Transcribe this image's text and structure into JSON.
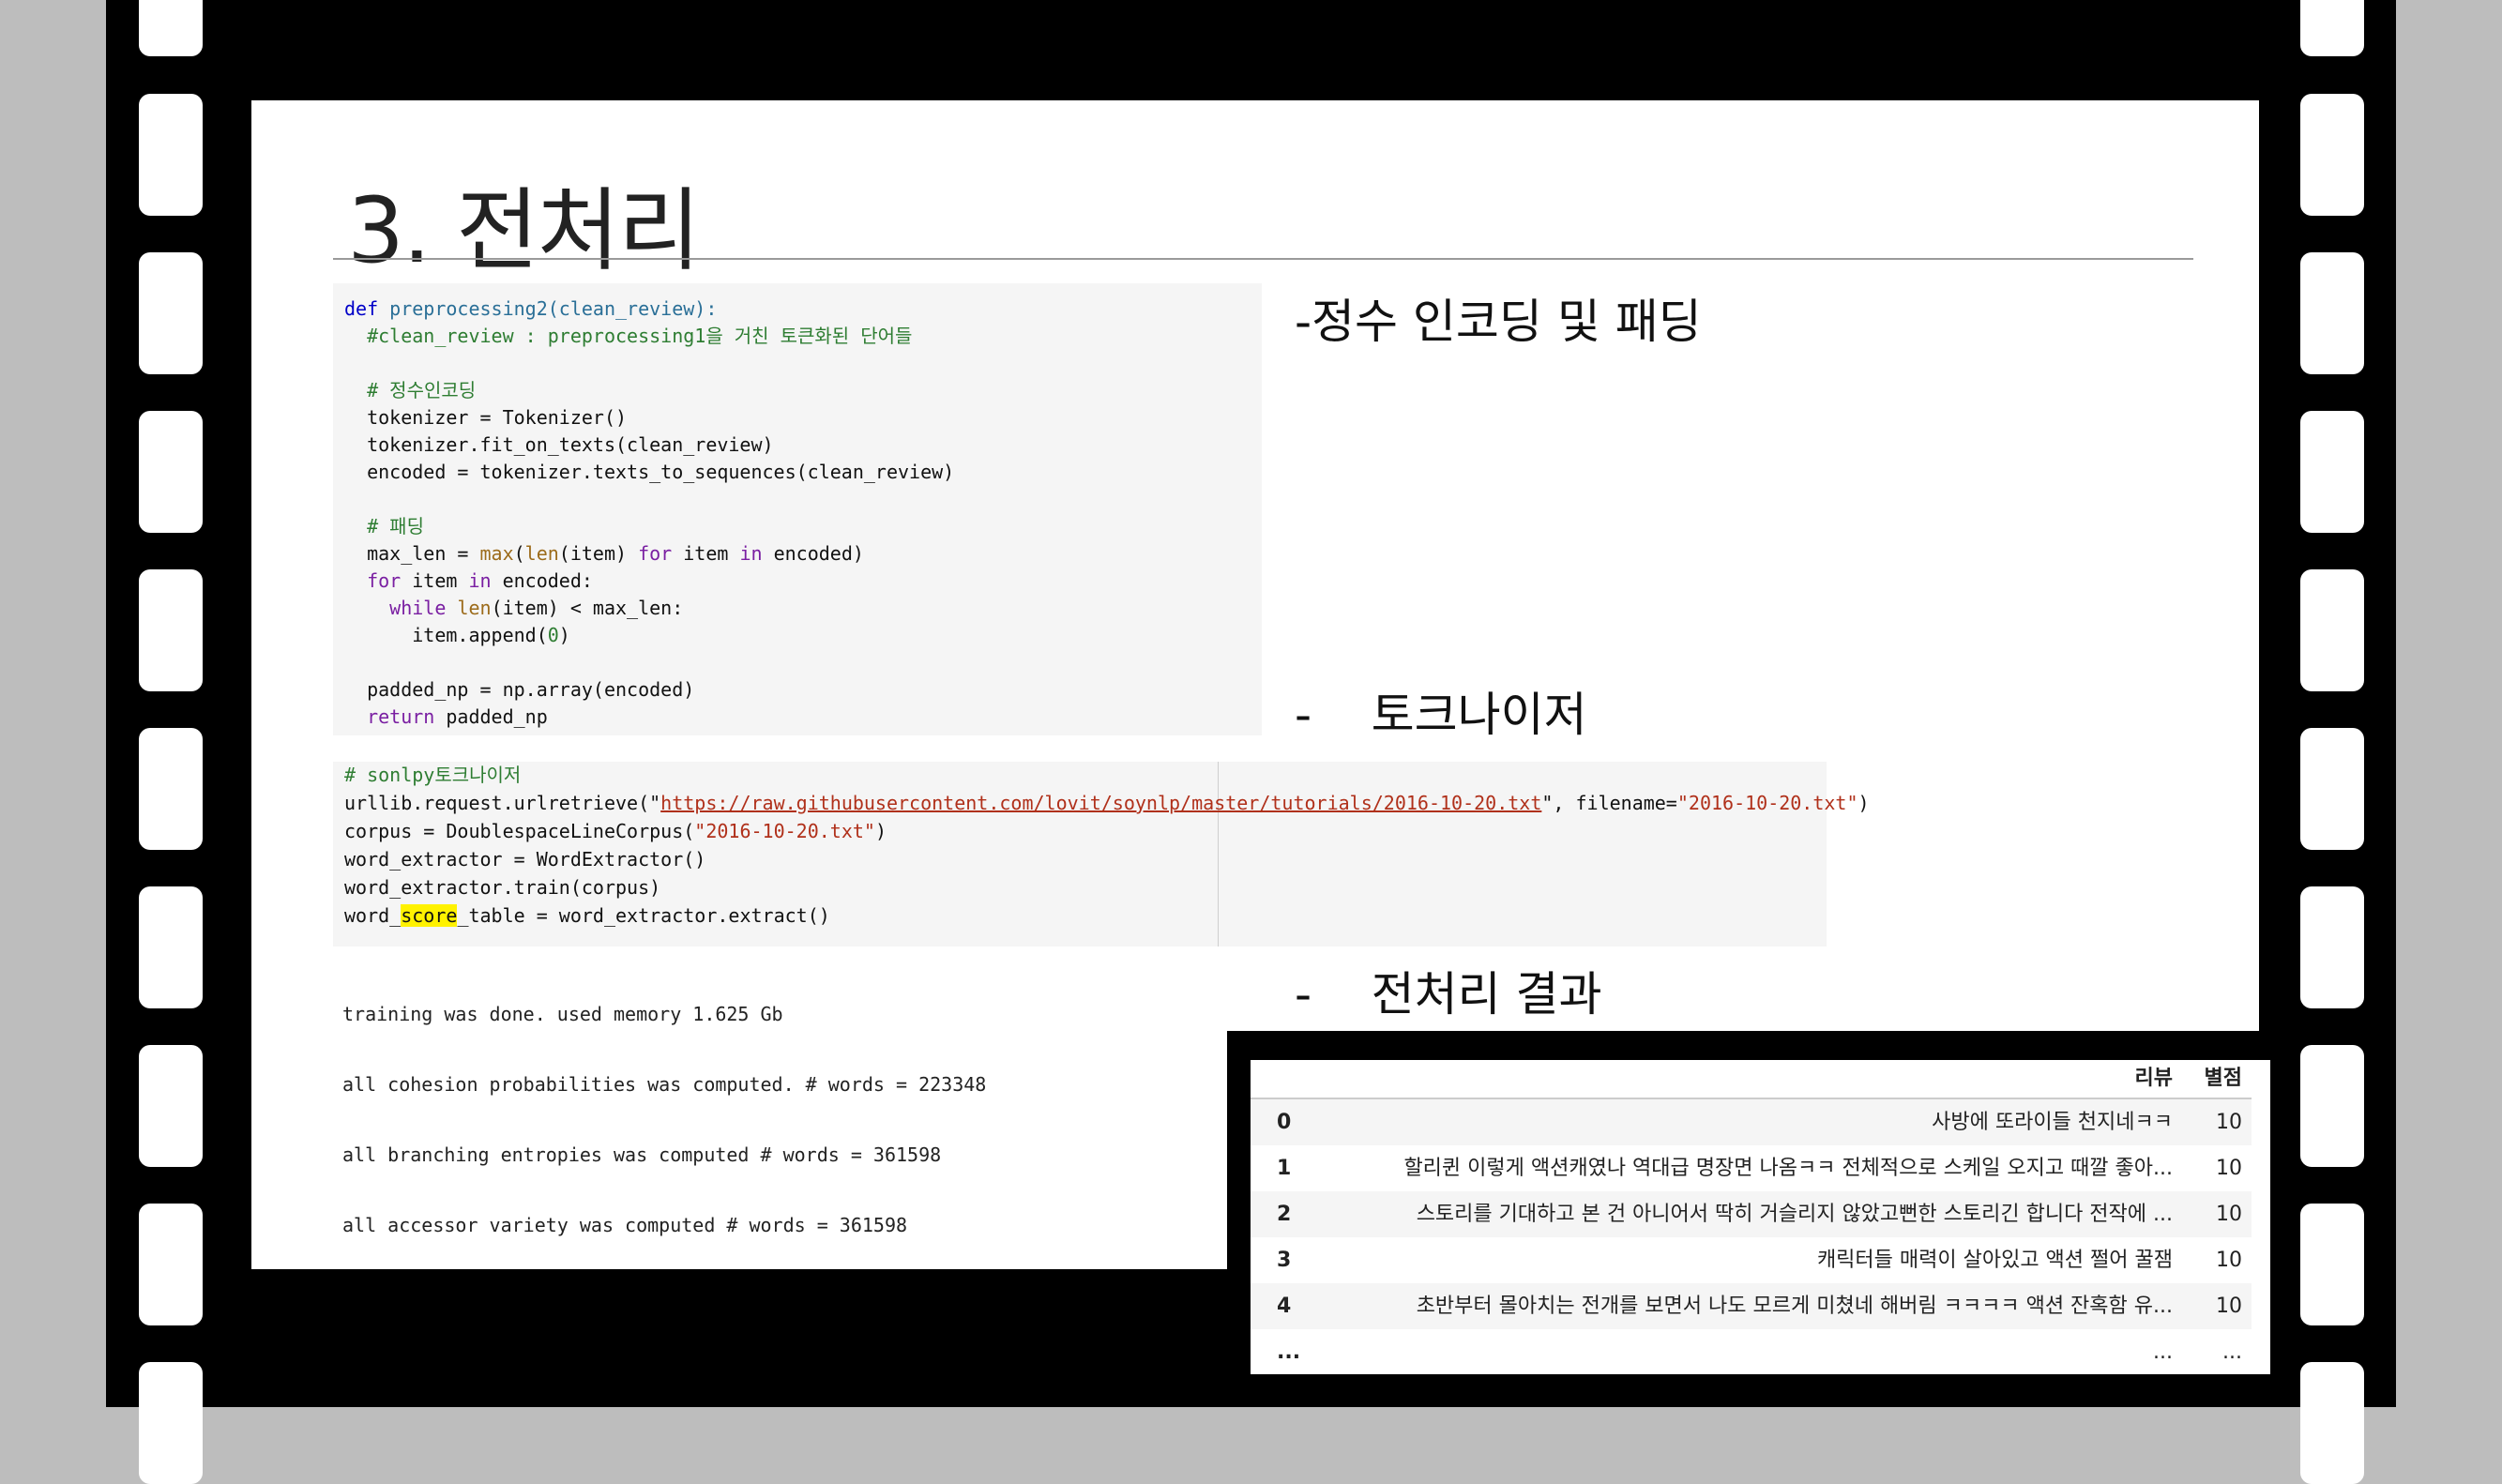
{
  "slide": {
    "title": "3. 전처리",
    "heading_encoding": "-정수 인코딩 및 패딩",
    "heading_tokenizer": "-    토크나이저",
    "heading_result": "-    전처리 결과"
  },
  "code_preprocessing": [
    "def preprocessing2(clean_review):",
    "  #clean_review : preprocessing1을 거친 토큰화된 단어들",
    "",
    "  # 정수인코딩",
    "  tokenizer = Tokenizer()",
    "  tokenizer.fit_on_texts(clean_review)",
    "  encoded = tokenizer.texts_to_sequences(clean_review)",
    "",
    "  # 패딩",
    "  max_len = max(len(item) for item in encoded)",
    "  for item in encoded:",
    "    while len(item) < max_len:",
    "      item.append(0)",
    "",
    "  padded_np = np.array(encoded)",
    "  return padded_np"
  ],
  "code_tokenizer": {
    "comment": "# sonlpy토크나이저",
    "line2_prefix": "urllib.request.urlretrieve(\"",
    "url": "https://raw.githubusercontent.com/lovit/soynlp/master/tutorials/2016-10-20.txt",
    "line2_mid": "\", filename=",
    "line2_filename": "\"2016-10-20.txt\"",
    "line2_suffix": ")",
    "line3_prefix": "corpus = DoublespaceLineCorpus(",
    "line3_str": "\"2016-10-20.txt\"",
    "line3_suffix": ")",
    "line4": "word_extractor = WordExtractor()",
    "line5": "word_extractor.train(corpus)",
    "line6_prefix": "word_",
    "line6_highlight": "score",
    "line6_suffix": "_table = word_extractor.extract()"
  },
  "output_lines": [
    "training was done. used memory 1.625 Gb",
    "all cohesion probabilities was computed. # words = 223348",
    "all branching entropies was computed # words = 361598",
    "all accessor variety was computed # words = 361598"
  ],
  "table": {
    "headers": [
      "리뷰",
      "별점"
    ],
    "rows": [
      {
        "idx": "0",
        "review": "사방에 또라이들 천지네ㅋㅋ",
        "score": "10"
      },
      {
        "idx": "1",
        "review": "할리퀸 이렇게 액션캐였나 역대급 명장면 나옴ㅋㅋ 전체적으로 스케일 오지고 때깔 좋아...",
        "score": "10"
      },
      {
        "idx": "2",
        "review": "스토리를 기대하고 본 건 아니어서 딱히 거슬리지 않았고뻔한 스토리긴 합니다 전작에 ...",
        "score": "10"
      },
      {
        "idx": "3",
        "review": "캐릭터들 매력이 살아있고 액션 쩔어 꿀잼",
        "score": "10"
      },
      {
        "idx": "4",
        "review": "초반부터 몰아치는 전개를 보면서 나도 모르게 미쳤네 해버림 ㅋㅋㅋㅋ 액션 잔혹함 유...",
        "score": "10"
      },
      {
        "idx": "...",
        "review": "...",
        "score": "..."
      }
    ]
  }
}
